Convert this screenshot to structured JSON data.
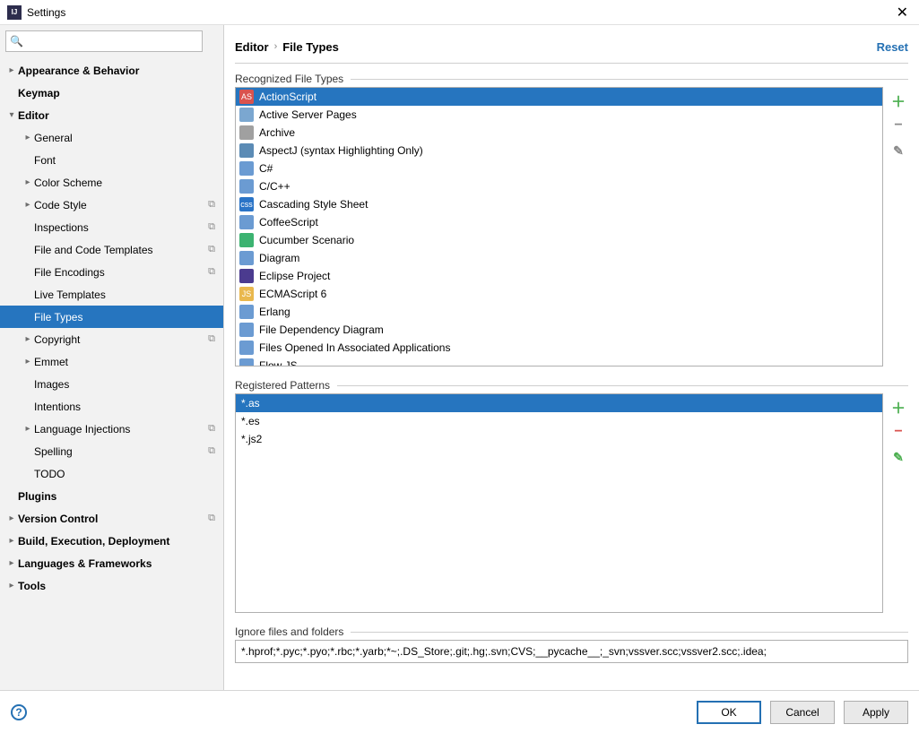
{
  "title": "Settings",
  "search": {
    "placeholder": ""
  },
  "sidebar": [
    {
      "label": "Appearance & Behavior",
      "bold": true,
      "indent": 0,
      "arrow": "▸",
      "badge": false
    },
    {
      "label": "Keymap",
      "bold": true,
      "indent": 0,
      "arrow": "",
      "badge": false
    },
    {
      "label": "Editor",
      "bold": true,
      "indent": 0,
      "arrow": "▾",
      "badge": false
    },
    {
      "label": "General",
      "bold": false,
      "indent": 1,
      "arrow": "▸",
      "badge": false
    },
    {
      "label": "Font",
      "bold": false,
      "indent": 1,
      "arrow": "",
      "badge": false
    },
    {
      "label": "Color Scheme",
      "bold": false,
      "indent": 1,
      "arrow": "▸",
      "badge": false
    },
    {
      "label": "Code Style",
      "bold": false,
      "indent": 1,
      "arrow": "▸",
      "badge": true
    },
    {
      "label": "Inspections",
      "bold": false,
      "indent": 1,
      "arrow": "",
      "badge": true
    },
    {
      "label": "File and Code Templates",
      "bold": false,
      "indent": 1,
      "arrow": "",
      "badge": true
    },
    {
      "label": "File Encodings",
      "bold": false,
      "indent": 1,
      "arrow": "",
      "badge": true
    },
    {
      "label": "Live Templates",
      "bold": false,
      "indent": 1,
      "arrow": "",
      "badge": false
    },
    {
      "label": "File Types",
      "bold": false,
      "indent": 1,
      "arrow": "",
      "badge": false,
      "selected": true
    },
    {
      "label": "Copyright",
      "bold": false,
      "indent": 1,
      "arrow": "▸",
      "badge": true
    },
    {
      "label": "Emmet",
      "bold": false,
      "indent": 1,
      "arrow": "▸",
      "badge": false
    },
    {
      "label": "Images",
      "bold": false,
      "indent": 1,
      "arrow": "",
      "badge": false
    },
    {
      "label": "Intentions",
      "bold": false,
      "indent": 1,
      "arrow": "",
      "badge": false
    },
    {
      "label": "Language Injections",
      "bold": false,
      "indent": 1,
      "arrow": "▸",
      "badge": true
    },
    {
      "label": "Spelling",
      "bold": false,
      "indent": 1,
      "arrow": "",
      "badge": true
    },
    {
      "label": "TODO",
      "bold": false,
      "indent": 1,
      "arrow": "",
      "badge": false
    },
    {
      "label": "Plugins",
      "bold": true,
      "indent": 0,
      "arrow": "",
      "badge": false
    },
    {
      "label": "Version Control",
      "bold": true,
      "indent": 0,
      "arrow": "▸",
      "badge": true
    },
    {
      "label": "Build, Execution, Deployment",
      "bold": true,
      "indent": 0,
      "arrow": "▸",
      "badge": false
    },
    {
      "label": "Languages & Frameworks",
      "bold": true,
      "indent": 0,
      "arrow": "▸",
      "badge": false
    },
    {
      "label": "Tools",
      "bold": true,
      "indent": 0,
      "arrow": "▸",
      "badge": false
    }
  ],
  "breadcrumb": {
    "parent": "Editor",
    "current": "File Types",
    "reset": "Reset"
  },
  "sections": {
    "recognized": "Recognized File Types",
    "patterns": "Registered Patterns",
    "ignore": "Ignore files and folders"
  },
  "filetypes": [
    {
      "label": "ActionScript",
      "selected": true,
      "iconColor": "#d9534f",
      "iconText": "AS"
    },
    {
      "label": "Active Server Pages",
      "iconColor": "#7ba7d0",
      "iconText": ""
    },
    {
      "label": "Archive",
      "iconColor": "#a0a0a0",
      "iconText": ""
    },
    {
      "label": "AspectJ (syntax Highlighting Only)",
      "iconColor": "#5b8bb5",
      "iconText": ""
    },
    {
      "label": "C#",
      "iconColor": "#6b9bd2",
      "iconText": ""
    },
    {
      "label": "C/C++",
      "iconColor": "#6b9bd2",
      "iconText": ""
    },
    {
      "label": "Cascading Style Sheet",
      "iconColor": "#2a74c7",
      "iconText": "css"
    },
    {
      "label": "CoffeeScript",
      "iconColor": "#6b9bd2",
      "iconText": ""
    },
    {
      "label": "Cucumber Scenario",
      "iconColor": "#3cb371",
      "iconText": ""
    },
    {
      "label": "Diagram",
      "iconColor": "#6b9bd2",
      "iconText": ""
    },
    {
      "label": "Eclipse Project",
      "iconColor": "#4b3b8f",
      "iconText": ""
    },
    {
      "label": "ECMAScript 6",
      "iconColor": "#e9b84e",
      "iconText": "JS"
    },
    {
      "label": "Erlang",
      "iconColor": "#6b9bd2",
      "iconText": ""
    },
    {
      "label": "File Dependency Diagram",
      "iconColor": "#6b9bd2",
      "iconText": ""
    },
    {
      "label": "Files Opened In Associated Applications",
      "iconColor": "#6b9bd2",
      "iconText": ""
    },
    {
      "label": "Flow JS",
      "iconColor": "#6b9bd2",
      "iconText": ""
    }
  ],
  "patterns": [
    {
      "label": "*.as",
      "selected": true
    },
    {
      "label": "*.es"
    },
    {
      "label": "*.js2"
    }
  ],
  "ignoreValue": "*.hprof;*.pyc;*.pyo;*.rbc;*.yarb;*~;.DS_Store;.git;.hg;.svn;CVS;__pycache__;_svn;vssver.scc;vssver2.scc;.idea;",
  "buttons": {
    "ok": "OK",
    "cancel": "Cancel",
    "apply": "Apply"
  }
}
